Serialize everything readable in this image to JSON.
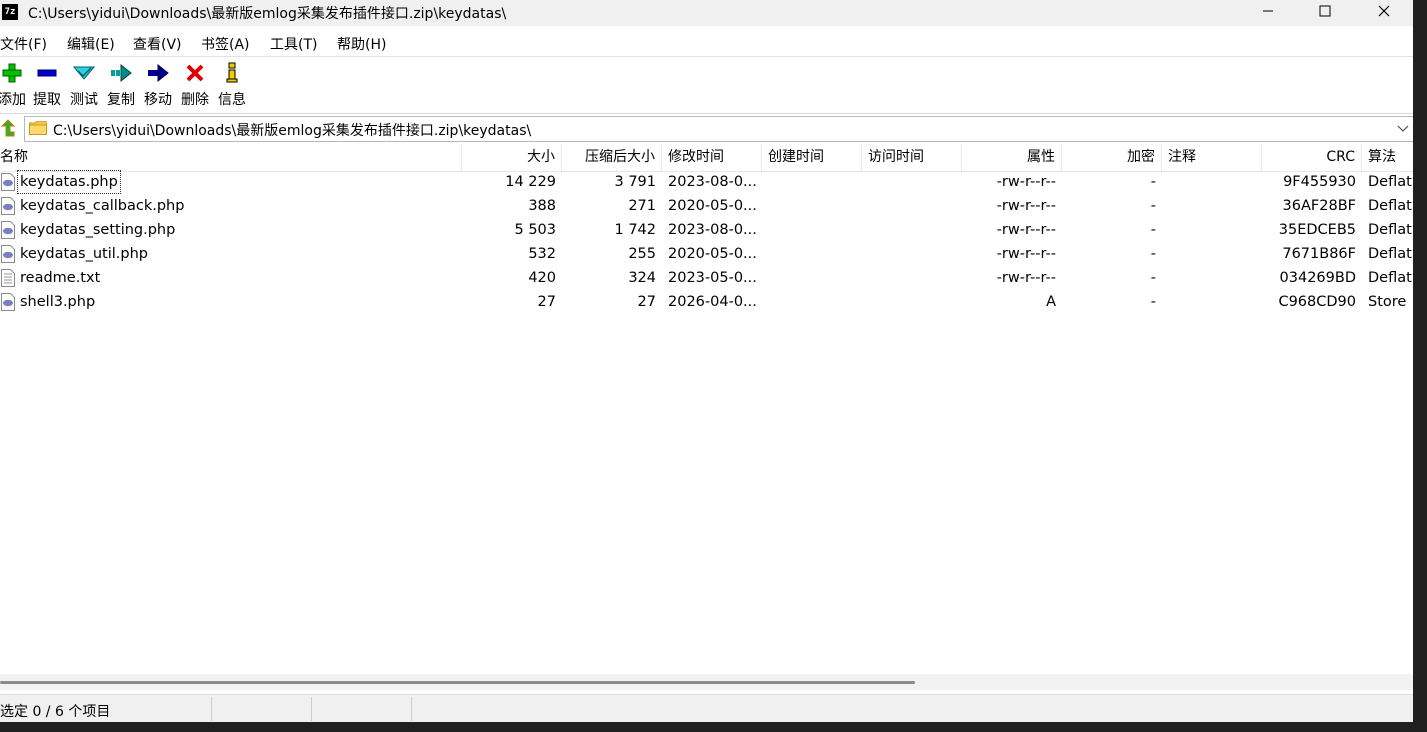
{
  "window": {
    "title": "C:\\Users\\yidui\\Downloads\\最新版emlog采集发布插件接口.zip\\keydatas\\",
    "app_icon_text": "7z"
  },
  "menu": [
    "文件(F)",
    "编辑(E)",
    "查看(V)",
    "书签(A)",
    "工具(T)",
    "帮助(H)"
  ],
  "toolbar": [
    {
      "label": "添加",
      "icon": "add-icon",
      "color": "#00c000"
    },
    {
      "label": "提取",
      "icon": "extract-icon",
      "color": "#0000c0"
    },
    {
      "label": "测试",
      "icon": "test-icon",
      "color": "#00a0c0"
    },
    {
      "label": "复制",
      "icon": "copy-icon",
      "color": "#008080"
    },
    {
      "label": "移动",
      "icon": "move-icon",
      "color": "#000080"
    },
    {
      "label": "删除",
      "icon": "delete-icon",
      "color": "#e00000"
    },
    {
      "label": "信息",
      "icon": "info-icon",
      "color": "#e0c000"
    }
  ],
  "address": {
    "path": "C:\\Users\\yidui\\Downloads\\最新版emlog采集发布插件接口.zip\\keydatas\\"
  },
  "columns": [
    "名称",
    "大小",
    "压缩后大小",
    "修改时间",
    "创建时间",
    "访问时间",
    "属性",
    "加密",
    "注释",
    "CRC",
    "算法"
  ],
  "files": [
    {
      "name": "keydatas.php",
      "type": "php",
      "size": "14 229",
      "packed": "3 791",
      "modified": "2023-08-0...",
      "created": "",
      "accessed": "",
      "attr": "-rw-r--r--",
      "encrypted": "-",
      "comment": "",
      "crc": "9F455930",
      "method": "Deflat"
    },
    {
      "name": "keydatas_callback.php",
      "type": "php",
      "size": "388",
      "packed": "271",
      "modified": "2020-05-0...",
      "created": "",
      "accessed": "",
      "attr": "-rw-r--r--",
      "encrypted": "-",
      "comment": "",
      "crc": "36AF28BF",
      "method": "Deflat"
    },
    {
      "name": "keydatas_setting.php",
      "type": "php",
      "size": "5 503",
      "packed": "1 742",
      "modified": "2023-08-0...",
      "created": "",
      "accessed": "",
      "attr": "-rw-r--r--",
      "encrypted": "-",
      "comment": "",
      "crc": "35EDCEB5",
      "method": "Deflat"
    },
    {
      "name": "keydatas_util.php",
      "type": "php",
      "size": "532",
      "packed": "255",
      "modified": "2020-05-0...",
      "created": "",
      "accessed": "",
      "attr": "-rw-r--r--",
      "encrypted": "-",
      "comment": "",
      "crc": "7671B86F",
      "method": "Deflat"
    },
    {
      "name": "readme.txt",
      "type": "txt",
      "size": "420",
      "packed": "324",
      "modified": "2023-05-0...",
      "created": "",
      "accessed": "",
      "attr": "-rw-r--r--",
      "encrypted": "-",
      "comment": "",
      "crc": "034269BD",
      "method": "Deflat"
    },
    {
      "name": "shell3.php",
      "type": "php",
      "size": "27",
      "packed": "27",
      "modified": "2026-04-0...",
      "created": "",
      "accessed": "",
      "attr": "A",
      "encrypted": "-",
      "comment": "",
      "crc": "C968CD90",
      "method": "Store"
    }
  ],
  "status": {
    "selection": "选定 0 / 6 个项目"
  }
}
